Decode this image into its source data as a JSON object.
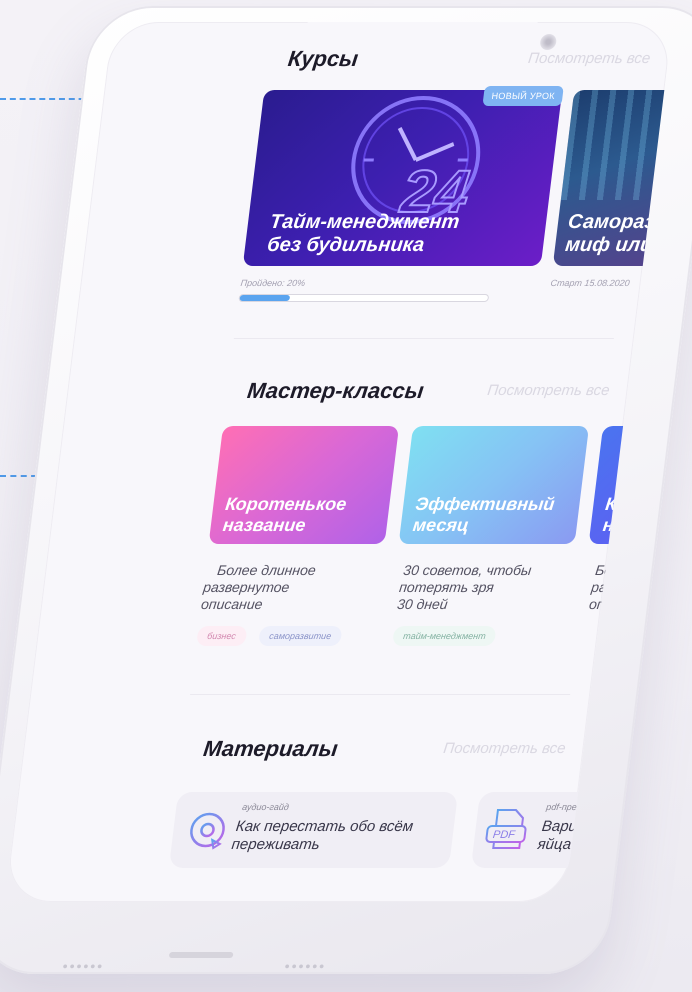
{
  "courses": {
    "title": "Курсы",
    "see_all": "Посмотреть все",
    "badge": "НОВЫЙ УРОК",
    "items": [
      {
        "title_line1": "Тайм-менеджмент",
        "title_line2": "без будильника",
        "meta": "Пройдено: 20%",
        "progress": 0.2
      },
      {
        "title_line1": "Саморазвит",
        "title_line2": "миф или ре",
        "meta": "Старт 15.08.2020"
      }
    ]
  },
  "masterclasses": {
    "title": "Мастер-классы",
    "see_all": "Посмотреть все",
    "items": [
      {
        "title_line1": "Коротенькое",
        "title_line2": "название",
        "desc_line1": "Более длинное",
        "desc_line2": "развернутое",
        "desc_line3": "описание"
      },
      {
        "title_line1": "Эффективный",
        "title_line2": "месяц",
        "desc_line1": "30 советов, чтобы",
        "desc_line2": "потерять зря",
        "desc_line3": "30 дней"
      },
      {
        "title_line1": "Кор",
        "title_line2": "наз",
        "desc_line1": "Бол",
        "desc_line2": "раз",
        "desc_line3": "опи"
      }
    ],
    "tags": [
      "бизнес",
      "саморазвитие",
      "тайм-менеджмент"
    ]
  },
  "materials": {
    "title": "Материалы",
    "see_all": "Посмотреть все",
    "items": [
      {
        "type": "аудио-гайд",
        "title_line1": "Как перестать обо всём",
        "title_line2": "переживать",
        "icon": "audio-disc-icon"
      },
      {
        "type": "pdf-пре",
        "title_line1": "Вари",
        "title_line2": "яйца",
        "icon": "pdf-file-icon",
        "icon_text": "PDF"
      }
    ]
  },
  "colors": {
    "accent": "#3f8fe8",
    "course1": [
      "#2a1c8f",
      "#6c1ec8"
    ],
    "mc1": [
      "#ff6fb4",
      "#b062e8"
    ],
    "mc2": [
      "#7fe0f2",
      "#8a9af2"
    ],
    "mc3": [
      "#4a74f0",
      "#5f5ef2"
    ]
  }
}
